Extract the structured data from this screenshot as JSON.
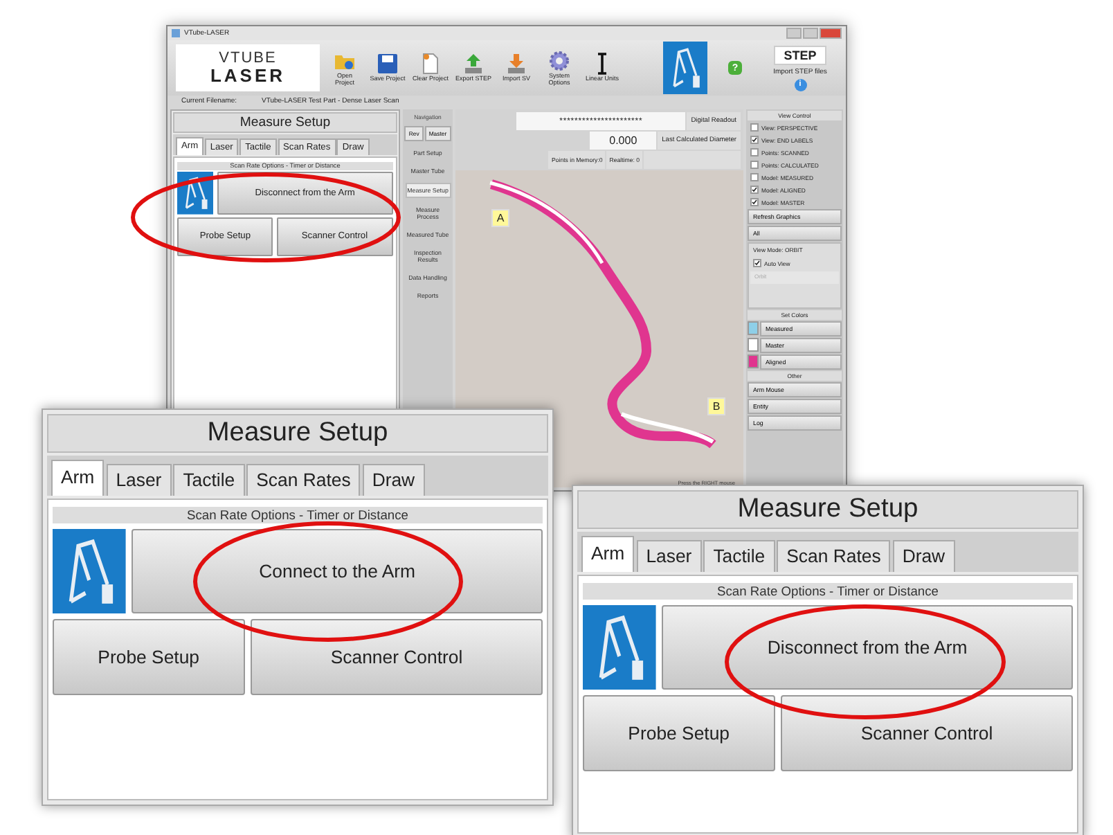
{
  "main_window": {
    "title": "VTube-LASER",
    "logo_text": [
      "VTUBE",
      "LASER"
    ],
    "toolbar": [
      {
        "kind": "folder",
        "label": "Open Project"
      },
      {
        "kind": "floppy",
        "label": "Save Project"
      },
      {
        "kind": "page",
        "label": "Clear Project"
      },
      {
        "kind": "export",
        "label": "Export STEP"
      },
      {
        "kind": "import",
        "label": "Import SV"
      },
      {
        "kind": "gear",
        "label": "System Options"
      },
      {
        "kind": "cursor",
        "label": "Linear Units"
      }
    ],
    "help_glyph": "?",
    "info_glyph": "i",
    "import_step": {
      "logo": "STEP",
      "label": "Import STEP files"
    },
    "filename_label": "Current Filename:",
    "filename": "VTube-LASER Test Part - Dense Laser Scan",
    "setup_panel": {
      "title": "Measure Setup",
      "tabs": [
        {
          "label": "Arm",
          "selected": true
        },
        {
          "label": "Laser",
          "selected": false
        },
        {
          "label": "Tactile",
          "selected": false
        },
        {
          "label": "Scan Rates",
          "selected": false
        },
        {
          "label": "Draw",
          "selected": false
        }
      ],
      "section": "Scan Rate Options - Timer or Distance",
      "arm_button": "Disconnect from the Arm",
      "buttons": [
        "Probe Setup",
        "Scanner Control"
      ]
    },
    "navigation": {
      "title": "Navigation",
      "buttons": [
        "Rev",
        "Master"
      ],
      "items": [
        {
          "label": "Part Setup",
          "selected": false
        },
        {
          "label": "Master Tube",
          "selected": false
        },
        {
          "label": "Measure Setup",
          "selected": true
        },
        {
          "label": "Measure Process",
          "selected": false
        },
        {
          "label": "Measured Tube",
          "selected": false
        },
        {
          "label": "Inspection Results",
          "selected": false
        },
        {
          "label": "Data Handling",
          "selected": false
        },
        {
          "label": "Reports",
          "selected": false
        }
      ]
    },
    "readout": {
      "value": "**********************",
      "value_label": "Digital Readout",
      "diameter": "0.000",
      "diameter_label": "Last Calculated Diameter",
      "points": "Points in Memory:0",
      "realtime": "Realtime: 0"
    },
    "viewport": {
      "end_labels": [
        "A",
        "B"
      ],
      "status": "Press the RIGHT mouse"
    },
    "view_control": {
      "title": "View Control",
      "options": [
        {
          "label": "View: PERSPECTIVE",
          "checked": false
        },
        {
          "label": "View: END LABELS",
          "checked": true
        },
        {
          "label": "Points: SCANNED",
          "checked": false
        },
        {
          "label": "Points: CALCULATED",
          "checked": false
        },
        {
          "label": "Model: MEASURED",
          "checked": false
        },
        {
          "label": "Model: ALIGNED",
          "checked": true
        },
        {
          "label": "Model: MASTER",
          "checked": true
        }
      ],
      "refresh": "Refresh Graphics",
      "filter": "All",
      "view_mode": "View Mode: ORBIT",
      "auto_view": {
        "label": "Auto View",
        "checked": true
      },
      "mode_field": {
        "value": "Orbit",
        "disabled": true
      },
      "colors_title": "Set Colors",
      "colors": [
        {
          "label": "Measured",
          "color": "#8ecfe8"
        },
        {
          "label": "Master",
          "color": "#ffffff"
        },
        {
          "label": "Aligned",
          "color": "#e0358f"
        }
      ],
      "other_title": "Other",
      "other_buttons": [
        "Arm Mouse",
        "Entity",
        "Log"
      ]
    }
  },
  "insets": [
    {
      "title": "Measure Setup",
      "tabs": [
        {
          "label": "Arm",
          "selected": true
        },
        {
          "label": "Laser",
          "selected": false
        },
        {
          "label": "Tactile",
          "selected": false
        },
        {
          "label": "Scan Rates",
          "selected": false
        },
        {
          "label": "Draw",
          "selected": false
        }
      ],
      "section": "Scan Rate Options - Timer or Distance",
      "arm_button": "Connect to the Arm",
      "buttons": [
        "Probe Setup",
        "Scanner Control"
      ]
    },
    {
      "title": "Measure Setup",
      "tabs": [
        {
          "label": "Arm",
          "selected": true
        },
        {
          "label": "Laser",
          "selected": false
        },
        {
          "label": "Tactile",
          "selected": false
        },
        {
          "label": "Scan Rates",
          "selected": false
        },
        {
          "label": "Draw",
          "selected": false
        }
      ],
      "section": "Scan Rate Options - Timer or Distance",
      "arm_button": "Disconnect from the Arm",
      "buttons": [
        "Probe Setup",
        "Scanner Control"
      ]
    }
  ]
}
